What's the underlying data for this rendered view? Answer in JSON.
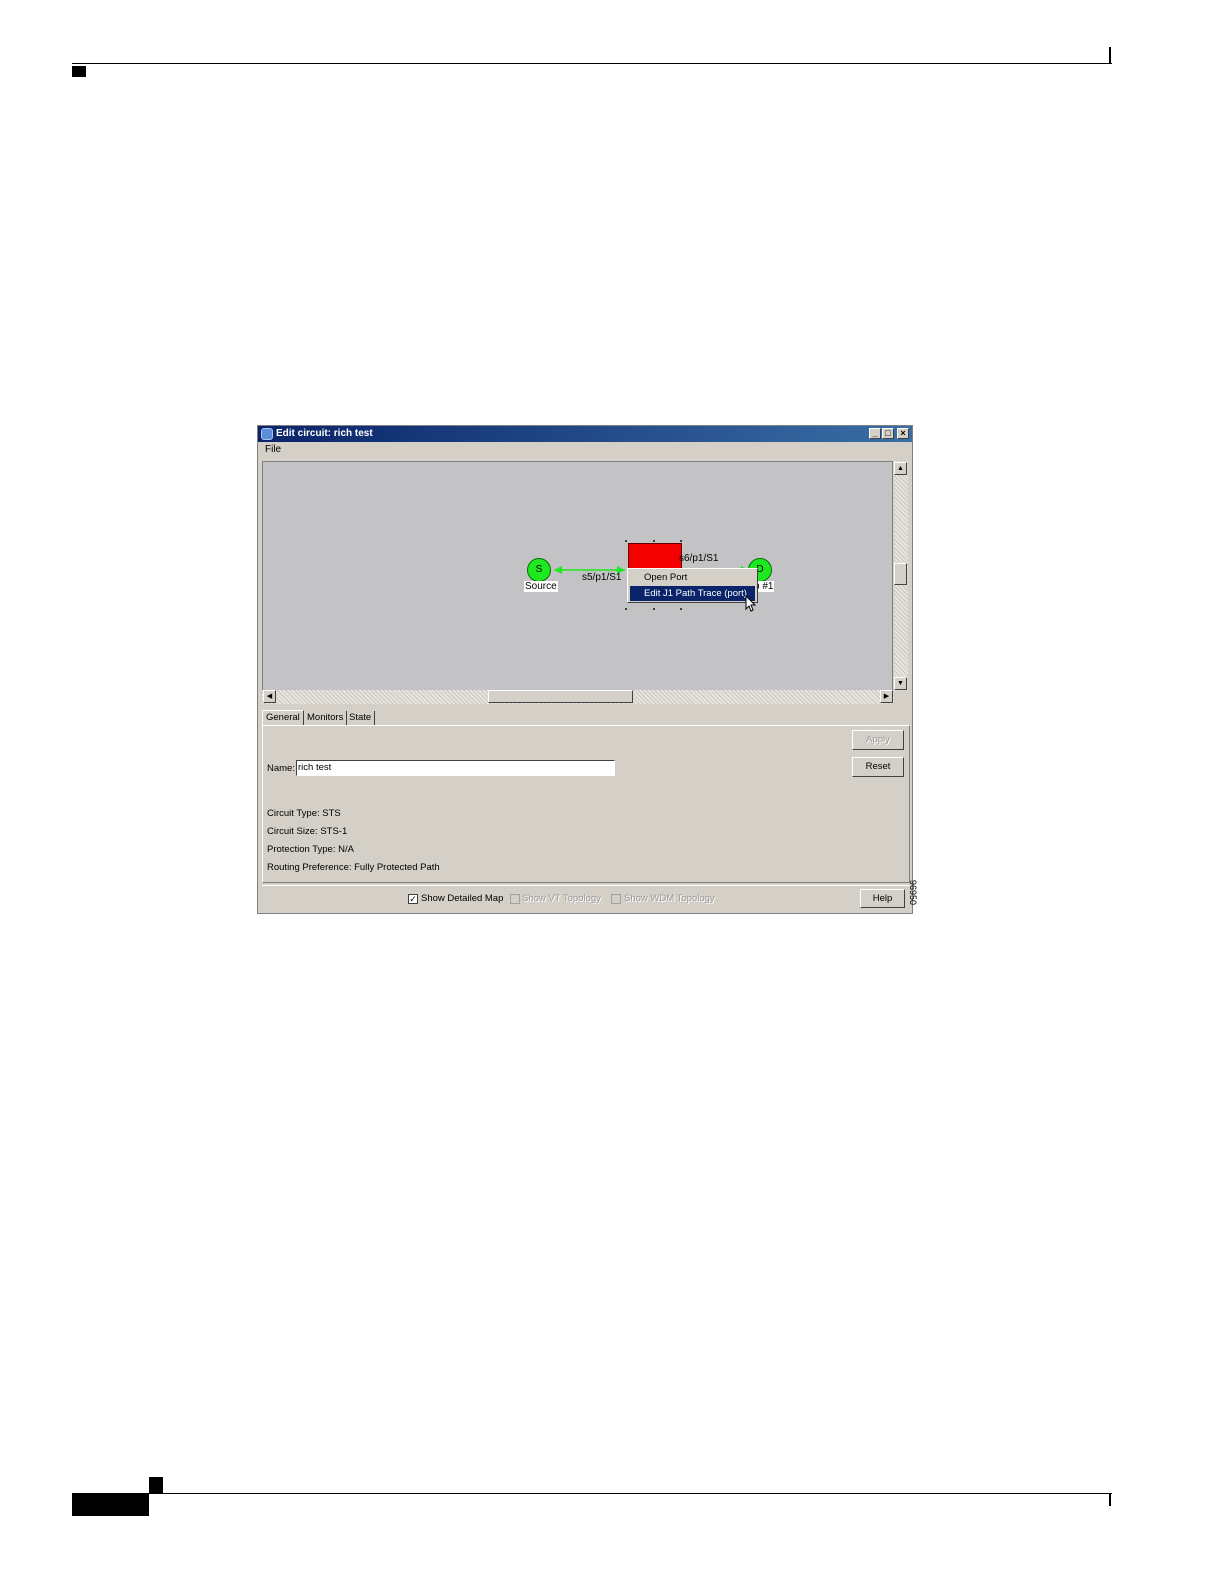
{
  "window": {
    "title": "Edit circuit: rich test",
    "minimize": "_",
    "maximize": "□",
    "close": "×",
    "menu": {
      "file": "File"
    }
  },
  "map": {
    "source_node": {
      "letter": "S",
      "label": "Source"
    },
    "dest_node": {
      "letter": "D",
      "label": "p #1"
    },
    "span_left_label": "s5/p1/S1",
    "span_right_label": "s6/p1/S1",
    "link_color": "#1ee81e",
    "node_box_color": "#f40000"
  },
  "context_menu": {
    "items": [
      "Open Port",
      "Edit J1 Path Trace (port)"
    ],
    "selected_index": 1
  },
  "tabs": [
    "General",
    "Monitors",
    "State"
  ],
  "active_tab": "General",
  "general": {
    "name_label": "Name:",
    "name_value": "rich test",
    "apply_label": "Apply",
    "reset_label": "Reset",
    "circuit_type": "Circuit Type:  STS",
    "circuit_size": "Circuit Size:  STS-1",
    "protection_type": "Protection Type:  N/A",
    "routing_preference": "Routing Preference: Fully Protected Path"
  },
  "bottom": {
    "show_detailed_map": {
      "label": "Show Detailed Map",
      "checked": true,
      "enabled": true
    },
    "show_vt_topology": {
      "label": "Show VT Topology",
      "checked": false,
      "enabled": false
    },
    "show_wdm_topology": {
      "label": "Show WDM Topology",
      "checked": false,
      "enabled": false
    },
    "help_label": "Help"
  },
  "figure_number": "96950"
}
